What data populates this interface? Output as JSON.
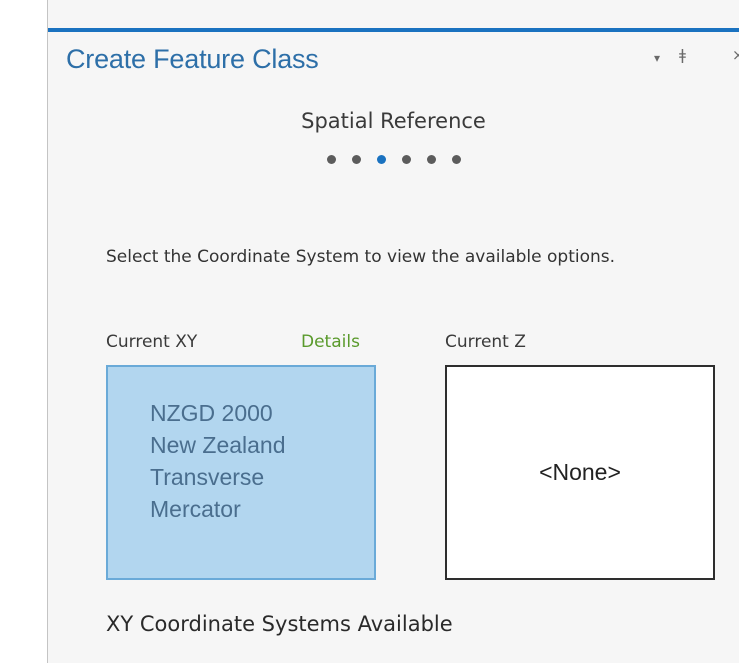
{
  "pane": {
    "title": "Create Feature Class",
    "controls": {
      "menu_glyph": "▾",
      "pin_glyph": "ǂ",
      "close_glyph": "×"
    }
  },
  "wizard": {
    "step_title": "Spatial Reference",
    "step_count": 6,
    "active_step": 3
  },
  "instructions": "Select the Coordinate System to view the available options.",
  "current_xy": {
    "label": "Current XY",
    "details_link": "Details",
    "lines": [
      "NZGD 2000",
      "New Zealand",
      "Transverse",
      "Mercator"
    ]
  },
  "current_z": {
    "label": "Current Z",
    "value": "<None>"
  },
  "available": {
    "heading": "XY Coordinate Systems Available"
  },
  "colors": {
    "accent": "#1a72c0",
    "title_text": "#2d6fa8",
    "details_link": "#5a9a2c",
    "xy_box_fill": "#b2d6ef",
    "xy_box_border": "#6aaad8",
    "pane_background": "#f6f6f6"
  }
}
